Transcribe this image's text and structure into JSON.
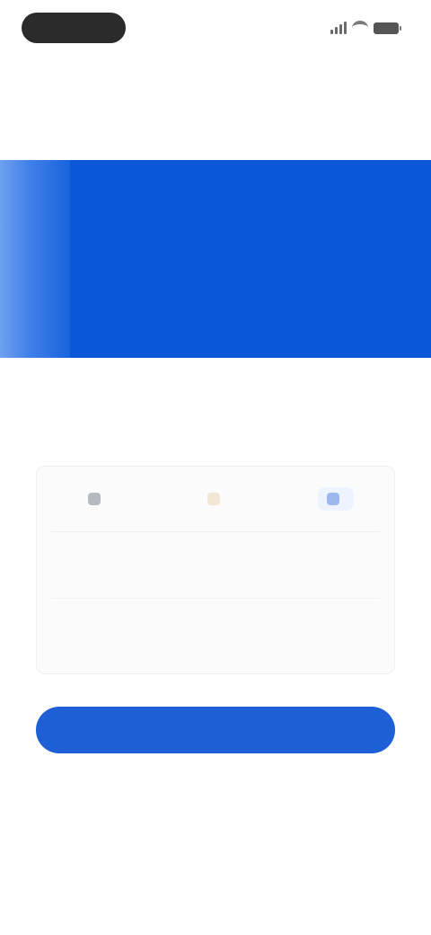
{
  "status_bar": {
    "app_pill_color": "#2b2b2b",
    "icons": [
      "signal-icon",
      "wifi-icon",
      "battery-icon"
    ]
  },
  "header": {
    "top_link": ""
  },
  "hero": {
    "title": "",
    "subtitle": "",
    "background": "#0a57d8"
  },
  "section": {
    "title": ""
  },
  "card": {
    "chips": [
      {
        "label": "",
        "icon": "card-icon"
      },
      {
        "label": "",
        "icon": "wallet-icon"
      },
      {
        "label": "",
        "icon": "bank-icon"
      }
    ],
    "body_text": "",
    "link_text": ""
  },
  "cta": {
    "label": "",
    "color": "#1f5fd6"
  },
  "footer": {
    "note": "",
    "link_text": ""
  }
}
